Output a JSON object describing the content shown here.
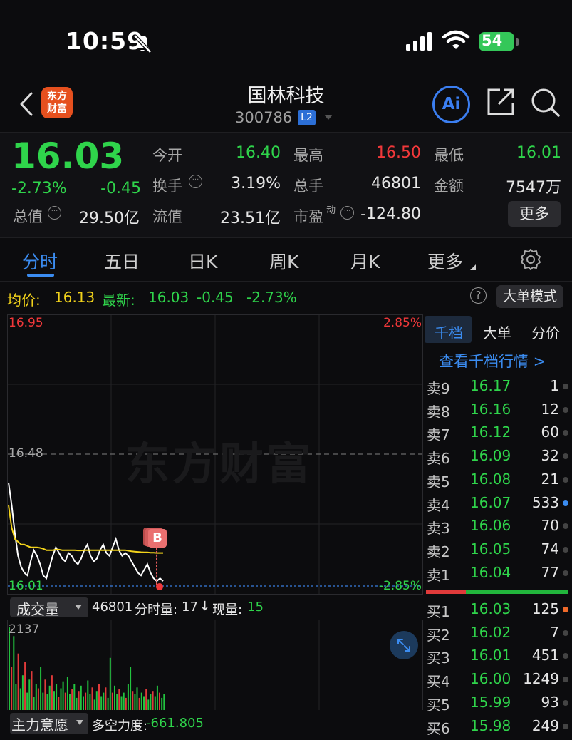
{
  "status": {
    "time": "10:59",
    "battery": "54"
  },
  "nav": {
    "app_logo_line1": "东方",
    "app_logo_line2": "财富",
    "title": "国林科技",
    "code": "300786",
    "level_badge": "L2",
    "ai_label": "Ai"
  },
  "quote": {
    "price": "16.03",
    "change_pct": "-2.73%",
    "change": "-0.45",
    "open_label": "今开",
    "open": "16.40",
    "high_label": "最高",
    "high": "16.50",
    "low_label": "最低",
    "low": "16.01",
    "turnover_label": "换手",
    "turnover": "3.19%",
    "total_hands_label": "总手",
    "total_hands": "46801",
    "amount_label": "金额",
    "amount": "7547万",
    "mktcap_label": "总值",
    "mktcap": "29.50亿",
    "float_label": "流值",
    "float": "23.51亿",
    "pe_label": "市盈",
    "pe_sup": "动",
    "pe": "-124.80",
    "more_button": "更多"
  },
  "tabs": [
    {
      "label": "分时"
    },
    {
      "label": "五日"
    },
    {
      "label": "日K"
    },
    {
      "label": "周K"
    },
    {
      "label": "月K"
    },
    {
      "label": "更多"
    }
  ],
  "avgbar": {
    "avg_label": "均价:",
    "avg": "16.13",
    "latest_label": "最新:",
    "latest": "16.03",
    "change": "-0.45",
    "change_pct": "-2.73%",
    "bigorder_button": "大单模式"
  },
  "chart": {
    "top_price": "16.95",
    "mid_price": "16.48",
    "bottom_price": "16.01",
    "top_pct": "2.85%",
    "bottom_pct": "-2.85%",
    "watermark": "东方财富",
    "marker": "B"
  },
  "chart_data": {
    "type": "line",
    "ylim": [
      16.01,
      16.95
    ],
    "reference": 16.48,
    "series": [
      {
        "values": [
          16.38,
          16.3,
          16.2,
          16.12,
          16.08,
          16.06,
          16.05,
          16.1,
          16.14,
          16.12,
          16.09,
          16.05,
          16.04,
          16.08,
          16.12,
          16.15,
          16.13,
          16.11,
          16.1,
          16.13,
          16.12,
          16.1,
          16.09,
          16.11,
          16.14,
          16.16,
          16.12,
          16.1,
          16.11,
          16.14,
          16.16,
          16.13,
          16.12,
          16.15,
          16.18,
          16.14,
          16.12,
          16.13,
          16.12,
          16.1,
          16.08,
          16.06,
          16.05,
          16.07,
          16.09,
          16.06,
          16.04,
          16.03,
          16.04,
          16.03
        ]
      },
      {
        "values": [
          16.3,
          16.22,
          16.18,
          16.17,
          16.16,
          16.16,
          16.155,
          16.15,
          16.15,
          16.15,
          16.148,
          16.145,
          16.14,
          16.14,
          16.14,
          16.142,
          16.142,
          16.14,
          16.14,
          16.14,
          16.14,
          16.14,
          16.139,
          16.139,
          16.14,
          16.14,
          16.14,
          16.14,
          16.14,
          16.14,
          16.14,
          16.14,
          16.14,
          16.14,
          16.14,
          16.14,
          16.14,
          16.14,
          16.138,
          16.136,
          16.135,
          16.134,
          16.133,
          16.132,
          16.132,
          16.131,
          16.131,
          16.13,
          16.13,
          16.13
        ]
      }
    ]
  },
  "volume": {
    "label": "成交量",
    "total": "46801",
    "tick_label": "分时量:",
    "tick": "17",
    "now_label": "现量:",
    "now": "15",
    "max": "2137",
    "bars": [
      0.95,
      0.5,
      0.85,
      0.3,
      0.65,
      0.25,
      0.4,
      0.55,
      0.2,
      0.35,
      0.45,
      0.15,
      0.3,
      0.25,
      0.5,
      0.2,
      0.35,
      0.18,
      0.28,
      0.4,
      0.22,
      0.3,
      0.15,
      0.25,
      0.33,
      0.2,
      0.38,
      0.18,
      0.24,
      0.3,
      0.14,
      0.22,
      0.28,
      0.16,
      0.2,
      0.34,
      0.18,
      0.26,
      0.12,
      0.22,
      0.3,
      0.16,
      0.2,
      0.26,
      0.14,
      0.6,
      0.2,
      0.28,
      0.18,
      0.24,
      0.16,
      0.2,
      0.14,
      0.3,
      0.5,
      0.22,
      0.18,
      0.26,
      0.14,
      0.2,
      0.16,
      0.24,
      0.12,
      0.18,
      0.22,
      0.16,
      0.28,
      0.2,
      0.14,
      0.18
    ]
  },
  "bottom": {
    "label": "主力意愿",
    "long_short_label": "多空力度:",
    "long_short": "-661.805"
  },
  "orderbook": {
    "tabs": [
      {
        "label": "千档"
      },
      {
        "label": "大单"
      },
      {
        "label": "分价"
      }
    ],
    "link": "查看千档行情 >",
    "asks": [
      {
        "label": "卖9",
        "price": "16.17",
        "vol": "1"
      },
      {
        "label": "卖8",
        "price": "16.16",
        "vol": "12"
      },
      {
        "label": "卖7",
        "price": "16.12",
        "vol": "60"
      },
      {
        "label": "卖6",
        "price": "16.09",
        "vol": "32"
      },
      {
        "label": "卖5",
        "price": "16.08",
        "vol": "21"
      },
      {
        "label": "卖4",
        "price": "16.07",
        "vol": "533"
      },
      {
        "label": "卖3",
        "price": "16.06",
        "vol": "70"
      },
      {
        "label": "卖2",
        "price": "16.05",
        "vol": "74"
      },
      {
        "label": "卖1",
        "price": "16.04",
        "vol": "77"
      }
    ],
    "bids": [
      {
        "label": "买1",
        "price": "16.03",
        "vol": "125"
      },
      {
        "label": "买2",
        "price": "16.02",
        "vol": "7"
      },
      {
        "label": "买3",
        "price": "16.01",
        "vol": "451"
      },
      {
        "label": "买4",
        "price": "16.00",
        "vol": "1249"
      },
      {
        "label": "买5",
        "price": "15.99",
        "vol": "93"
      },
      {
        "label": "买6",
        "price": "15.98",
        "vol": "249"
      }
    ]
  }
}
